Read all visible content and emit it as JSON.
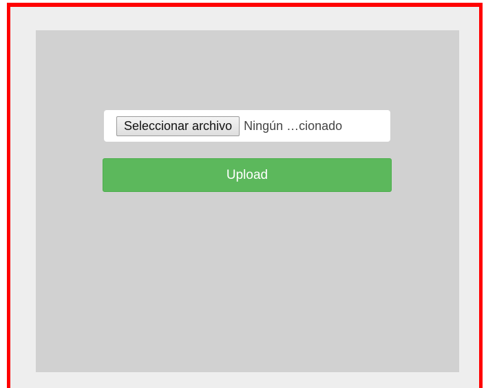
{
  "file_input": {
    "choose_label": "Seleccionar archivo",
    "status_text": "Ningún …cionado"
  },
  "actions": {
    "upload_label": "Upload"
  },
  "colors": {
    "frame_border": "#ff0000",
    "frame_background": "#eeeeee",
    "panel_background": "#d1d1d1",
    "upload_button": "#5cb85c"
  }
}
